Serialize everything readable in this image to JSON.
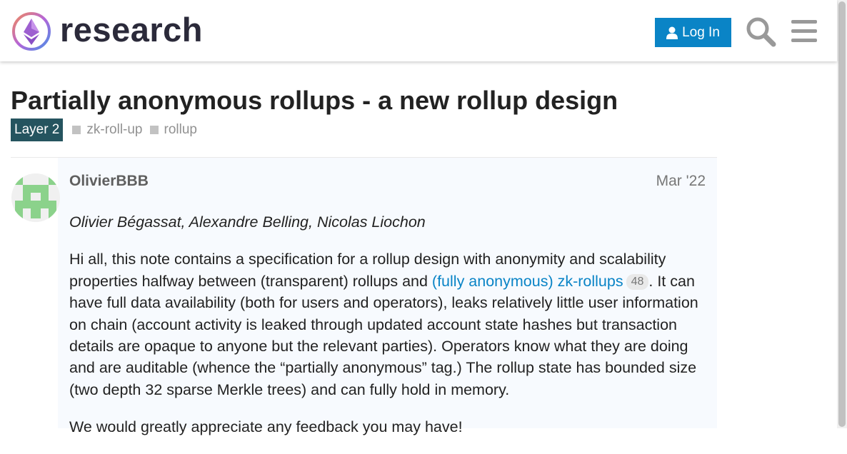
{
  "header": {
    "logo_text": "research",
    "login_label": "Log In",
    "search_icon": "search-icon",
    "menu_icon": "hamburger-menu-icon",
    "accent": "#0a84c6"
  },
  "topic": {
    "title": "Partially anonymous rollups - a new rollup design",
    "category": {
      "label": "Layer 2",
      "color": "#25545f"
    },
    "tags": [
      "zk-roll-up",
      "rollup"
    ]
  },
  "post": {
    "username": "OlivierBBB",
    "date": "Mar '22",
    "authors": "Olivier Bégassat, Alexandre Belling, Nicolas Liochon",
    "p1_before": "Hi all, this note contains a specification for a rollup design with anonymity and scalability properties halfway between (transparent) rollups and ",
    "p1_link": "(fully anonymous) zk-rollups",
    "p1_link_clicks": "48",
    "p1_after": ". It can have full data availability (both for users and operators), leaks relatively little user information on chain (account activity is leaked through updated account state hashes but transaction details are opaque to anyone but the relevant parties). Operators know what they are doing and are auditable (whence the “partially anonymous” tag.) The rollup state has bounded size (two depth 32 sparse Merkle trees) and can fully hold in memory.",
    "p2": "We would greatly appreciate any feedback you may have!"
  }
}
